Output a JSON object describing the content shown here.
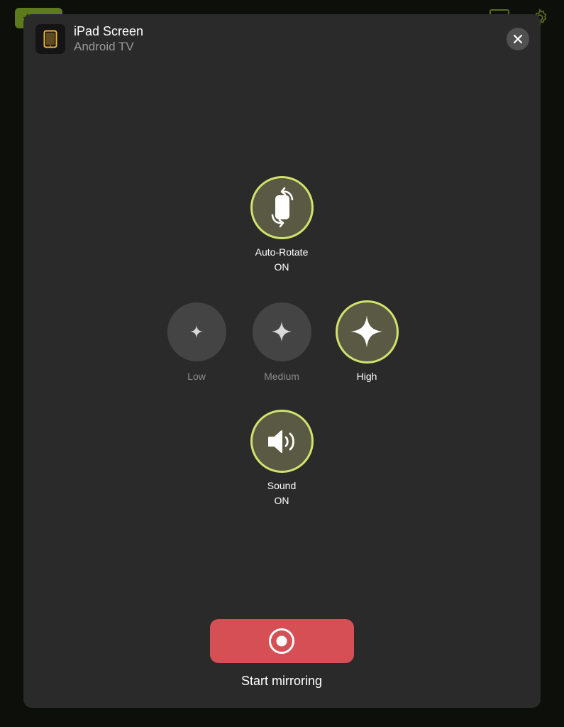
{
  "background": {
    "badge_text": "✓"
  },
  "header": {
    "title": "iPad Screen",
    "subtitle": "Android TV",
    "device_icon": "tablet-icon",
    "close_icon": "close-icon"
  },
  "controls": {
    "auto_rotate": {
      "label": "Auto-Rotate",
      "state": "ON",
      "icon": "rotate-icon"
    },
    "quality": {
      "options": [
        {
          "label": "Low",
          "icon": "sparkle-icon",
          "selected": false
        },
        {
          "label": "Medium",
          "icon": "sparkle-icon",
          "selected": false
        },
        {
          "label": "High",
          "icon": "sparkle-icon",
          "selected": true
        }
      ]
    },
    "sound": {
      "label": "Sound",
      "state": "ON",
      "icon": "speaker-icon"
    }
  },
  "start": {
    "label": "Start mirroring",
    "icon": "record-icon"
  },
  "colors": {
    "accent_ring": "#d2e36c",
    "active_fill": "#5a5a44",
    "inactive_fill": "#444444",
    "start_button": "#d64f55",
    "modal_bg": "#2a2a2a"
  }
}
